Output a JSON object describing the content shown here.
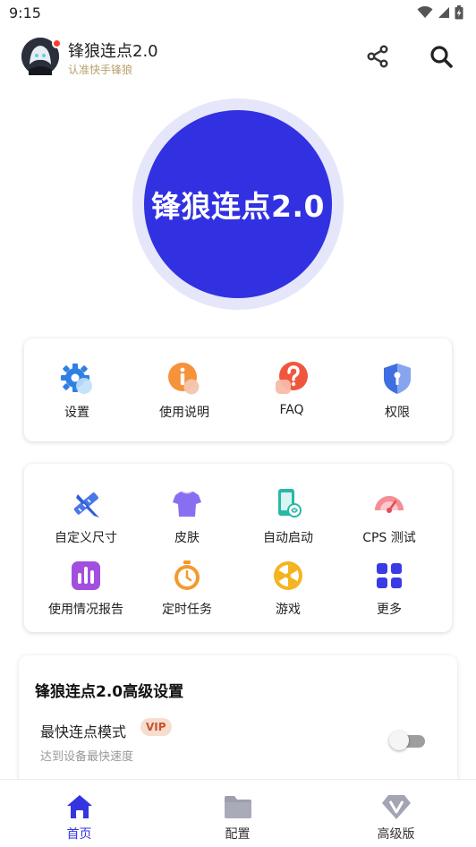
{
  "status_bar": {
    "time": "9:15"
  },
  "header": {
    "title": "锋狼连点2.0",
    "subtitle": "认准快手锋狼",
    "share_icon": "share-icon",
    "search_icon": "search-icon"
  },
  "main_button": {
    "label": "锋狼连点2.0"
  },
  "quick_menu": [
    {
      "label": "设置",
      "icon": "gear-icon"
    },
    {
      "label": "使用说明",
      "icon": "info-icon"
    },
    {
      "label": "FAQ",
      "icon": "question-icon"
    },
    {
      "label": "权限",
      "icon": "shield-icon"
    }
  ],
  "features": [
    {
      "label": "自定义尺寸",
      "icon": "ruler-pencil-icon"
    },
    {
      "label": "皮肤",
      "icon": "tshirt-icon"
    },
    {
      "label": "自动启动",
      "icon": "phone-auto-icon"
    },
    {
      "label": "CPS 测试",
      "icon": "speedometer-icon"
    },
    {
      "label": "使用情况报告",
      "icon": "bar-chart-icon"
    },
    {
      "label": "定时任务",
      "icon": "stopwatch-icon"
    },
    {
      "label": "游戏",
      "icon": "game-wheel-icon"
    },
    {
      "label": "更多",
      "icon": "grid-more-icon"
    }
  ],
  "advanced": {
    "title": "锋狼连点2.0高级设置",
    "option_title": "最快连点模式",
    "option_badge": "VIP",
    "option_desc": "达到设备最快速度",
    "option_enabled": false
  },
  "bottom_nav": [
    {
      "label": "首页",
      "icon": "home-icon",
      "active": true
    },
    {
      "label": "配置",
      "icon": "folder-icon",
      "active": false
    },
    {
      "label": "高级版",
      "icon": "diamond-v-icon",
      "active": false
    }
  ],
  "colors": {
    "primary": "#3131e2",
    "ring": "#e6e6fb",
    "vip_bg": "#f7ddd0",
    "vip_text": "#c8542c"
  }
}
